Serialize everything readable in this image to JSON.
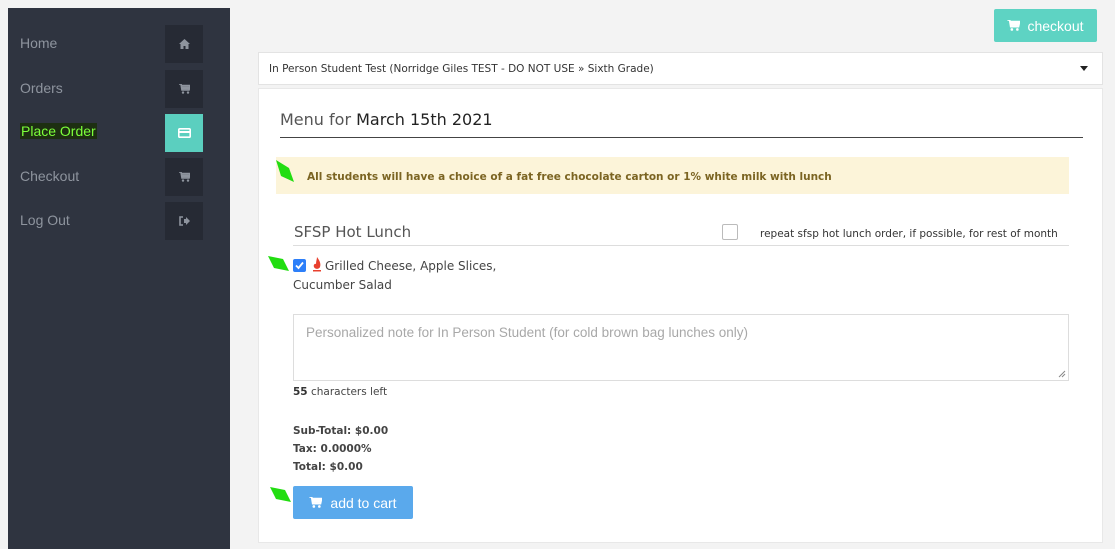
{
  "sidebar": {
    "items": [
      {
        "label": "Home",
        "icon": "home-icon"
      },
      {
        "label": "Orders",
        "icon": "cart-icon"
      },
      {
        "label": "Place Order",
        "icon": "credit-card-icon",
        "active": true
      },
      {
        "label": "Checkout",
        "icon": "cart-icon"
      },
      {
        "label": "Log Out",
        "icon": "sign-out-icon"
      }
    ]
  },
  "header": {
    "checkout_label": "checkout"
  },
  "student_select": {
    "selected": "In Person Student Test (Norridge Giles TEST - DO NOT USE » Sixth Grade)"
  },
  "menu": {
    "title_prefix": "Menu for ",
    "date": "March 15th 2021"
  },
  "notice": {
    "text": "All students will have a choice of a fat free chocolate carton or 1% white milk with lunch"
  },
  "section": {
    "title": "SFSP Hot Lunch",
    "repeat_label": "repeat sfsp hot lunch order, if possible, for rest of month",
    "repeat_checked": false
  },
  "item": {
    "checked": true,
    "name_line1": "Grilled Cheese, Apple Slices,",
    "name_line2": "Cucumber Salad"
  },
  "note": {
    "placeholder": "Personalized note for In Person Student (for cold brown bag lunches only)",
    "value": ""
  },
  "chars_left": {
    "count": "55",
    "suffix": " characters left"
  },
  "totals": {
    "subtotal": "Sub-Total: $0.00",
    "tax": "Tax: 0.0000%",
    "total": "Total: $0.00"
  },
  "cart": {
    "add_label": "add to cart"
  },
  "colors": {
    "sidebar_bg": "#2f3440",
    "accent_teal": "#5ed3c3",
    "button_blue": "#5aa9ec",
    "notice_bg": "#fcf4d9",
    "active_label": "#7cff3a"
  }
}
